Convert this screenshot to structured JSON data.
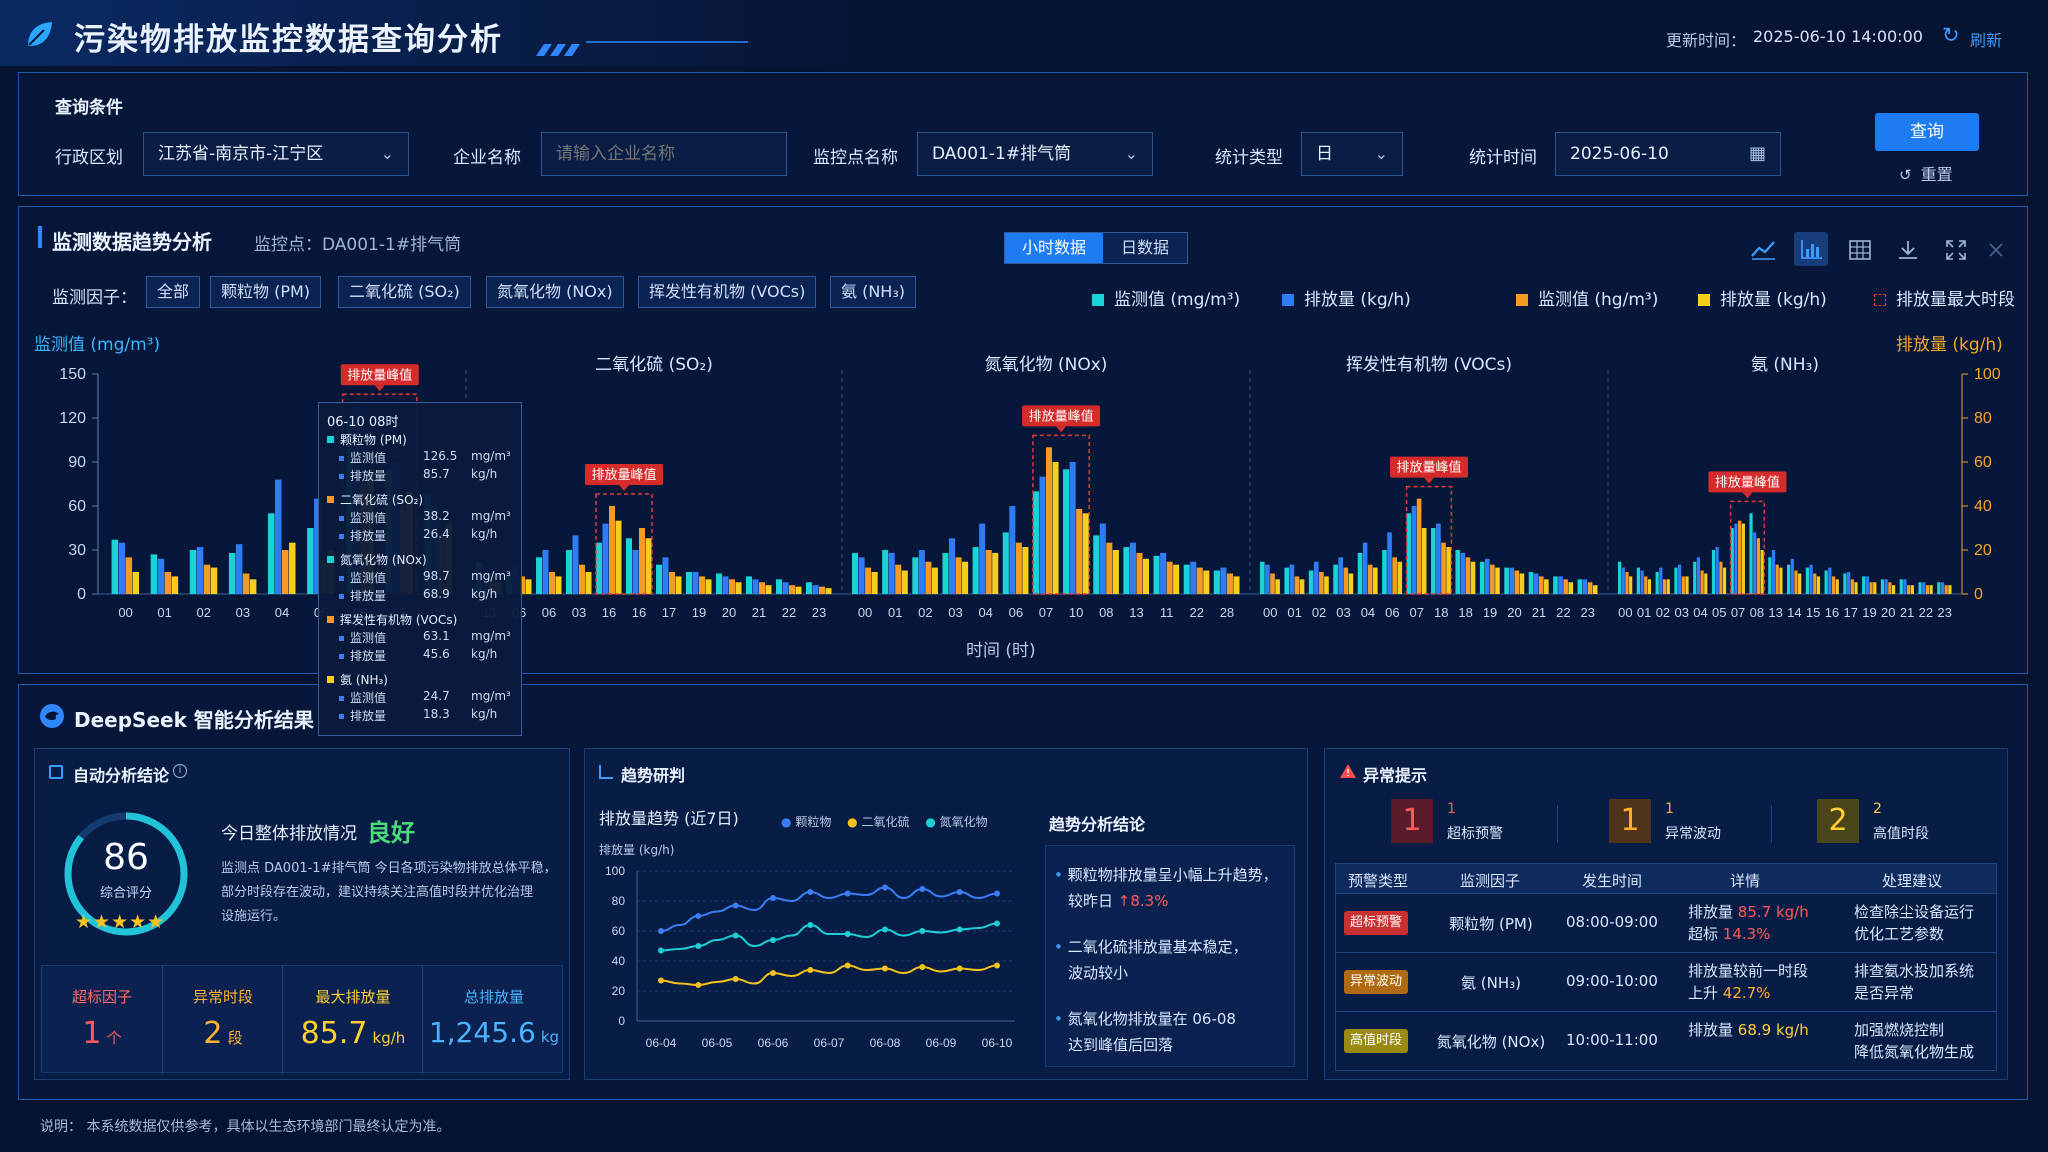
{
  "header": {
    "title": "污染物排放监控数据查询分析",
    "updated_label": "更新时间：",
    "updated_time": "2025-06-10 14:00:00",
    "refresh_label": "刷新"
  },
  "query": {
    "section_title": "查询条件",
    "region_label": "行政区划",
    "region_value": "江苏省-南京市-江宁区",
    "company_label": "企业名称",
    "company_placeholder": "请输入企业名称",
    "monitor_label": "监控点名称",
    "monitor_value": "DA001-1#排气筒",
    "stat_type_label": "统计类型",
    "stat_type_value": "日",
    "stat_time_label": "统计时间",
    "stat_time_value": "2025-06-10",
    "search_button": "查询",
    "reset_button": "重置"
  },
  "trend": {
    "title": "监测数据趋势分析",
    "monitor_point": "监控点：DA001-1#排气筒",
    "tabs": [
      "小时数据",
      "日数据"
    ],
    "active_tab": 0,
    "factor_label": "监测因子：",
    "factors": [
      "全部",
      "颗粒物 (PM)",
      "二氧化硫 (SO₂)",
      "氮氧化物 (NOx)",
      "挥发性有机物 (VOCs)",
      "氨 (NH₃)"
    ],
    "legend": [
      {
        "label": "监测值 (mg/m³)",
        "color": "#19d3d6"
      },
      {
        "label": "排放量 (kg/h)",
        "color": "#2f7df6"
      },
      {
        "label": "监测值 (hg/m³)",
        "color": "#f59a23"
      },
      {
        "label": "排放量 (kg/h)",
        "color": "#f5cf1b"
      },
      {
        "label": "排放量最大时段",
        "color": "#e33a3a"
      }
    ],
    "y_left_label": "监测值 (mg/m³)",
    "y_right_label": "排放量 (kg/h)",
    "x_label": "时间 (时)",
    "peak_label": "排放量峰值"
  },
  "chart_data": {
    "type": "bar",
    "y_left_ticks": [
      "150",
      "120",
      "90",
      "60",
      "30",
      "0"
    ],
    "y_right_ticks": [
      "100",
      "80",
      "60",
      "40",
      "20",
      "0"
    ],
    "ylim_left": [
      0,
      150
    ],
    "ylim_right": [
      0,
      100
    ],
    "groups": [
      {
        "name": "",
        "x": [
          "00",
          "01",
          "02",
          "03",
          "04",
          "05",
          "06",
          "08",
          "09"
        ],
        "peak": [
          6,
          7
        ],
        "series": [
          [
            37,
            27,
            30,
            28,
            55,
            45,
            120,
            85,
            68
          ],
          [
            35,
            24,
            32,
            34,
            78,
            65,
            128,
            90,
            60
          ],
          [
            25,
            15,
            20,
            14,
            30,
            22,
            75,
            60,
            40
          ],
          [
            15,
            12,
            18,
            10,
            35,
            30,
            85,
            70,
            48
          ]
        ]
      },
      {
        "name": "二氧化硫 (SO₂)",
        "x": [
          "13",
          "06",
          "06",
          "03",
          "16",
          "16",
          "17",
          "19",
          "20",
          "21",
          "22",
          "23"
        ],
        "peak": [
          4,
          5
        ],
        "series": [
          [
            22,
            15,
            25,
            30,
            35,
            38,
            20,
            15,
            14,
            12,
            10,
            8
          ],
          [
            12,
            20,
            30,
            40,
            48,
            30,
            25,
            15,
            12,
            10,
            8,
            6
          ],
          [
            10,
            12,
            15,
            20,
            60,
            45,
            15,
            12,
            10,
            8,
            6,
            5
          ],
          [
            8,
            10,
            12,
            15,
            50,
            38,
            12,
            10,
            8,
            6,
            5,
            4
          ]
        ]
      },
      {
        "name": "氮氧化物 (NOx)",
        "x": [
          "00",
          "01",
          "02",
          "03",
          "04",
          "06",
          "07",
          "10",
          "08",
          "13",
          "11",
          "22",
          "28"
        ],
        "peak": [
          6,
          7
        ],
        "series": [
          [
            28,
            30,
            25,
            28,
            32,
            42,
            70,
            85,
            40,
            32,
            26,
            20,
            16
          ],
          [
            25,
            28,
            30,
            38,
            48,
            60,
            80,
            90,
            48,
            35,
            28,
            22,
            18
          ],
          [
            18,
            20,
            22,
            25,
            30,
            35,
            100,
            58,
            35,
            28,
            22,
            18,
            14
          ],
          [
            15,
            16,
            18,
            22,
            28,
            32,
            90,
            55,
            30,
            24,
            20,
            16,
            12
          ]
        ]
      },
      {
        "name": "挥发性有机物 (VOCs)",
        "x": [
          "00",
          "01",
          "02",
          "03",
          "04",
          "06",
          "07",
          "18",
          "18",
          "19",
          "20",
          "21",
          "22",
          "23"
        ],
        "peak": [
          6,
          7
        ],
        "series": [
          [
            22,
            18,
            16,
            20,
            28,
            30,
            55,
            45,
            30,
            22,
            18,
            15,
            12,
            10
          ],
          [
            20,
            20,
            22,
            25,
            35,
            42,
            60,
            48,
            28,
            24,
            18,
            14,
            12,
            10
          ],
          [
            14,
            12,
            15,
            18,
            20,
            25,
            65,
            35,
            25,
            20,
            16,
            12,
            10,
            8
          ],
          [
            10,
            10,
            12,
            14,
            18,
            22,
            45,
            32,
            22,
            18,
            14,
            10,
            8,
            6
          ]
        ]
      },
      {
        "name": "氨 (NH₃)",
        "x": [
          "00",
          "01",
          "02",
          "03",
          "04",
          "05",
          "07",
          "08",
          "13",
          "14",
          "15",
          "16",
          "17",
          "19",
          "20",
          "21",
          "22",
          "23"
        ],
        "peak": [
          6,
          7
        ],
        "series": [
          [
            22,
            18,
            15,
            18,
            22,
            30,
            45,
            55,
            25,
            20,
            18,
            16,
            14,
            12,
            10,
            10,
            8,
            8
          ],
          [
            18,
            16,
            18,
            20,
            25,
            32,
            48,
            42,
            30,
            24,
            20,
            18,
            15,
            12,
            10,
            10,
            8,
            8
          ],
          [
            15,
            12,
            10,
            12,
            16,
            22,
            50,
            38,
            20,
            16,
            14,
            12,
            10,
            8,
            8,
            6,
            6,
            6
          ],
          [
            12,
            10,
            10,
            12,
            14,
            18,
            48,
            30,
            18,
            14,
            12,
            10,
            8,
            8,
            6,
            6,
            6,
            6
          ]
        ]
      }
    ],
    "tooltip": {
      "time": "06-10 08时",
      "items": [
        {
          "name": "颗粒物 (PM)",
          "color": "#19d3d6",
          "m_label": "监测值",
          "m_value": "126.5",
          "m_unit": "mg/m³",
          "e_label": "排放量",
          "e_value": "85.7",
          "e_unit": "kg/h"
        },
        {
          "name": "二氧化硫 (SO₂)",
          "color": "#f59a23",
          "m_label": "监测值",
          "m_value": "38.2",
          "m_unit": "mg/m³",
          "e_label": "排放量",
          "e_value": "26.4",
          "e_unit": "kg/h"
        },
        {
          "name": "氮氧化物 (NOx)",
          "color": "#19d3d6",
          "m_label": "监测值",
          "m_value": "98.7",
          "m_unit": "mg/m³",
          "e_label": "排放量",
          "e_value": "68.9",
          "e_unit": "kg/h"
        },
        {
          "name": "挥发性有机物 (VOCs)",
          "color": "#f59a23",
          "m_label": "监测值",
          "m_value": "63.1",
          "m_unit": "mg/m³",
          "e_label": "排放量",
          "e_value": "45.6",
          "e_unit": "kg/h"
        },
        {
          "name": "氨 (NH₃)",
          "color": "#f5cf1b",
          "m_label": "监测值",
          "m_value": "24.7",
          "m_unit": "mg/m³",
          "e_label": "排放量",
          "e_value": "18.3",
          "e_unit": "kg/h"
        }
      ]
    },
    "weekly": {
      "type": "line",
      "title": "排放量趋势 (近7日)",
      "ylabel": "排放量 (kg/h)",
      "ylim": [
        0,
        100
      ],
      "y_ticks": [
        "100",
        "80",
        "60",
        "40",
        "20",
        "0"
      ],
      "x_ticks": [
        "06-04",
        "06-05",
        "06-06",
        "06-07",
        "06-08",
        "06-09",
        "06-10"
      ],
      "series": [
        {
          "name": "颗粒物",
          "color": "#3b7df5",
          "values": [
            60,
            64,
            70,
            73,
            77,
            74,
            82,
            80,
            86,
            82,
            85,
            84,
            89,
            82,
            88,
            83,
            86,
            82,
            85
          ]
        },
        {
          "name": "二氧化硫",
          "color": "#f5c21b",
          "values": [
            27,
            25,
            24,
            26,
            28,
            25,
            32,
            30,
            34,
            32,
            37,
            34,
            35,
            32,
            36,
            33,
            35,
            34,
            37
          ]
        },
        {
          "name": "氮氧化物",
          "color": "#1fcfd8",
          "values": [
            47,
            48,
            50,
            54,
            57,
            50,
            54,
            57,
            64,
            58,
            58,
            56,
            61,
            57,
            60,
            59,
            61,
            62,
            65
          ]
        }
      ]
    }
  },
  "deepseek": {
    "title": "DeepSeek 智能分析结果",
    "auto": {
      "title": "自动分析结论",
      "score": "86",
      "score_label": "综合评分",
      "stars": "★★★★★",
      "headline": "今日整体排放情况",
      "status": "良好",
      "desc_lines": [
        "监测点 DA001-1#排气筒 今日各项污染物排放总体平稳，",
        "部分时段存在波动，建议持续关注高值时段并优化治理",
        "设施运行。"
      ],
      "stats": [
        {
          "label": "超标因子",
          "value": "1",
          "unit": "个",
          "color": "#ff5a5a"
        },
        {
          "label": "异常时段",
          "value": "2",
          "unit": "段",
          "color": "#ffb02e"
        },
        {
          "label": "最大排放量",
          "value": "85.7",
          "unit": "kg/h",
          "color": "#ffcf33"
        },
        {
          "label": "总排放量",
          "value": "1,245.6",
          "unit": "kg",
          "color": "#4cb3ff"
        }
      ]
    },
    "trend_judge": {
      "title": "趋势研判",
      "conclusion_title": "趋势分析结论",
      "conclusions": [
        {
          "text1": "颗粒物排放量呈小幅上升趋势，",
          "text2": "较昨日 ",
          "highlight": "↑8.3%"
        },
        {
          "text1": "二氧化硫排放量基本稳定，",
          "text2": "波动较小",
          "highlight": ""
        },
        {
          "text1": "氮氧化物排放量在 06-08",
          "text2": "达到峰值后回落",
          "highlight": ""
        }
      ]
    },
    "anomaly": {
      "title": "异常提示",
      "counters": [
        {
          "num": "1",
          "small": "1",
          "label": "超标预警",
          "color": "#ff5a5a",
          "bg": "#5a1c2a"
        },
        {
          "num": "1",
          "small": "1",
          "label": "异常波动",
          "color": "#ffb02e",
          "bg": "#4e3418"
        },
        {
          "num": "2",
          "small": "2",
          "label": "高值时段",
          "color": "#ffcf33",
          "bg": "#4a4518"
        }
      ],
      "headers": [
        "预警类型",
        "监测因子",
        "发生时间",
        "详情",
        "处理建议"
      ],
      "rows": [
        {
          "tag": "超标预警",
          "tag_color": "#c93131",
          "factor": "颗粒物 (PM)",
          "time": "08:00-09:00",
          "d1": "排放量 ",
          "d1v": "85.7 kg/h",
          "d2": "超标 ",
          "d2v": "14.3%",
          "s1": "检查除尘设备运行",
          "s2": "优化工艺参数"
        },
        {
          "tag": "异常波动",
          "tag_color": "#b06a12",
          "factor": "氨 (NH₃)",
          "time": "09:00-10:00",
          "d1": "排放量较前一时段",
          "d1v": "",
          "d2": "上升 ",
          "d2v": "42.7%",
          "s1": "排查氨水投加系统",
          "s2": "是否异常"
        },
        {
          "tag": "高值时段",
          "tag_color": "#9a8a14",
          "factor": "氮氧化物 (NOx)",
          "time": "10:00-11:00",
          "d1": "排放量 ",
          "d1v": "68.9 kg/h",
          "d2": "",
          "d2v": "",
          "s1": "加强燃烧控制",
          "s2": "降低氮氧化物生成"
        }
      ]
    }
  },
  "footer": {
    "note": "说明：  本系统数据仅供参考，具体以生态环境部门最终认定为准。"
  }
}
